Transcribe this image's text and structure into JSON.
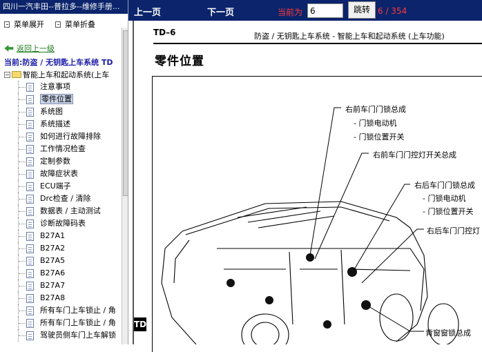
{
  "window": {
    "title": "四川一汽丰田--普拉多--维修手册..."
  },
  "left": {
    "expand_label": "菜单展开",
    "collapse_label": "菜单折叠",
    "back_label": "返回上一级",
    "current_label": "当前:防盗 / 无钥匙上车系统 TD",
    "root_label": "智能上车和起动系统(上车",
    "items": [
      {
        "label": "注意事项"
      },
      {
        "label": "零件位置"
      },
      {
        "label": "系统图"
      },
      {
        "label": "系统描述"
      },
      {
        "label": "如何进行故障排除"
      },
      {
        "label": "工作情况检查"
      },
      {
        "label": "定制参数"
      },
      {
        "label": "故障症状表"
      },
      {
        "label": "ECU端子"
      },
      {
        "label": "Drc检查 / 清除"
      },
      {
        "label": "数据表 / 主动测试"
      },
      {
        "label": "诊断故障码表"
      },
      {
        "label": "B27A1"
      },
      {
        "label": "B27A2"
      },
      {
        "label": "B27A5"
      },
      {
        "label": "B27A6"
      },
      {
        "label": "B27A7"
      },
      {
        "label": "B27A8"
      },
      {
        "label": "所有车门上车锁止 / 角"
      },
      {
        "label": "所有车门上车锁止 / 角"
      },
      {
        "label": "驾驶员侧车门上车解锁"
      }
    ],
    "selected_index": 1
  },
  "nav": {
    "prev_label": "上一页",
    "next_label": "下一页",
    "current_page_label": "当前为",
    "page_value": "6",
    "jump_label": "跳转",
    "page_count": "6 / 354"
  },
  "doc": {
    "code": "TD–6",
    "header": "防盗 / 无钥匙上车系统 - 智能上车和起动系统 (上车功能)",
    "title": "零件位置",
    "side_tab": "TD",
    "callouts": [
      {
        "text": "右前车门门锁总成"
      },
      {
        "text": "- 门锁电动机"
      },
      {
        "text": "- 门锁位置开关"
      },
      {
        "text": "右前车门门控灯开关总成"
      },
      {
        "text": "右后车门门锁总成"
      },
      {
        "text": "- 门锁电动机"
      },
      {
        "text": "- 门锁位置开关"
      },
      {
        "text": "右后车门门控灯"
      },
      {
        "text": "背窗窗锁总成"
      }
    ]
  }
}
